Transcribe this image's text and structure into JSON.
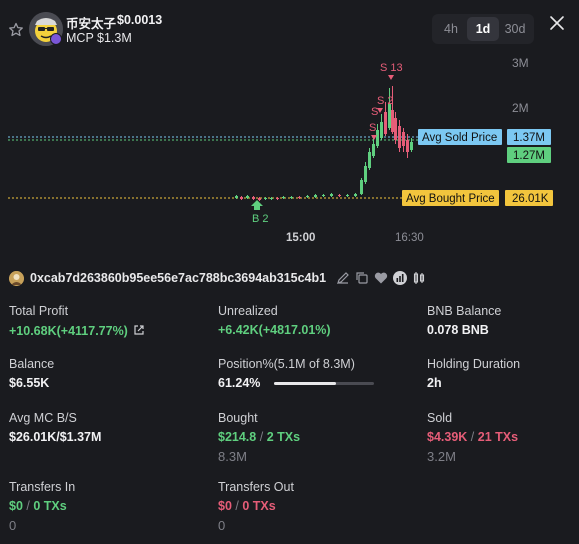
{
  "token": {
    "name": "币安太子",
    "price": "$0.0013",
    "mcp": "MCP $1.3M"
  },
  "timeframes": [
    {
      "label": "4h",
      "active": false
    },
    {
      "label": "1d",
      "active": true
    },
    {
      "label": "30d",
      "active": false
    }
  ],
  "chart": {
    "y_ticks": [
      "3M",
      "2M"
    ],
    "x_ticks": [
      "15:00",
      "16:30"
    ],
    "markers": {
      "sell_top": "S 13",
      "sell_mid": "S 2",
      "sell_low1": "S",
      "sell_low2": "S",
      "buy": "B 2"
    },
    "avg_sold_label": "Avg Sold Price",
    "avg_sold_value": "1.37M",
    "current_value": "1.27M",
    "avg_bought_label": "Avg Bought Price",
    "avg_bought_value": "26.01K",
    "colors": {
      "up": "#5fcf7f",
      "down": "#e65d78",
      "avg_sold": "#7cc8f2",
      "avg_bought": "#f2c53d"
    }
  },
  "wallet": {
    "address": "0xcab7d263860b95ee56e7ac788bc3694ab315c4b1",
    "icons": [
      "edit-icon",
      "copy-icon",
      "heart-icon",
      "chart-icon",
      "candles-icon"
    ]
  },
  "stats": {
    "total_profit": {
      "label": "Total Profit",
      "value": "+10.68K(+4117.77%)"
    },
    "unrealized": {
      "label": "Unrealized",
      "value": "+6.42K(+4817.01%)"
    },
    "bnb_balance": {
      "label": "BNB Balance",
      "value": "0.078 BNB"
    },
    "balance": {
      "label": "Balance",
      "value": "$6.55K"
    },
    "position": {
      "label": "Position%(5.1M of 8.3M)",
      "value": "61.24%",
      "fraction": 0.6124
    },
    "holding_duration": {
      "label": "Holding Duration",
      "value": "2h"
    },
    "avg_mc": {
      "label": "Avg MC B/S",
      "value": "$26.01K/$1.37M"
    },
    "bought": {
      "label": "Bought",
      "amount": "$214.8",
      "sep": "/",
      "txs": "2 TXs",
      "sub": "8.3M"
    },
    "sold": {
      "label": "Sold",
      "amount": "$4.39K",
      "sep": "/",
      "txs": "21 TXs",
      "sub": "3.2M"
    },
    "transfers_in": {
      "label": "Transfers In",
      "amount": "$0",
      "sep": "/",
      "txs": "0 TXs",
      "sub": "0"
    },
    "transfers_out": {
      "label": "Transfers Out",
      "amount": "$0",
      "sep": "/",
      "txs": "0 TXs",
      "sub": "0"
    }
  }
}
